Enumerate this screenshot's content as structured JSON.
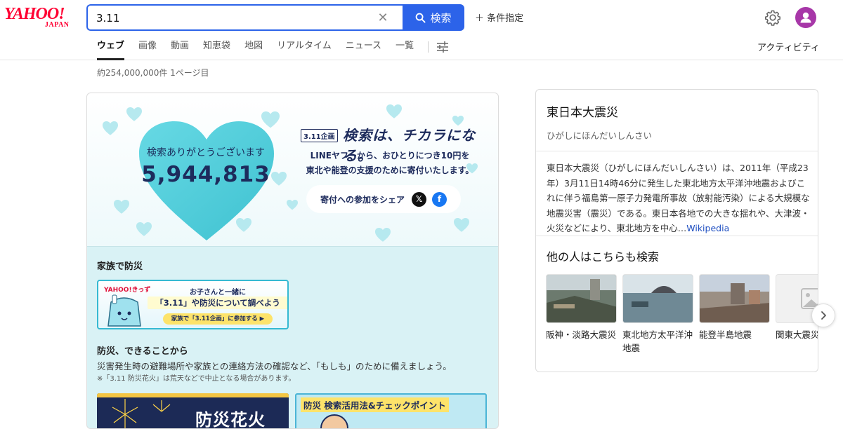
{
  "logo": {
    "line1": "YAHOO!",
    "line2": "JAPAN"
  },
  "search": {
    "query": "3.11",
    "placeholder": "",
    "button_label": "検索"
  },
  "header": {
    "conditions_label": "条件指定",
    "activity_label": "アクティビティ",
    "avatar_color": "#a737a8"
  },
  "tabs": [
    {
      "label": "ウェブ",
      "active": true
    },
    {
      "label": "画像"
    },
    {
      "label": "動画"
    },
    {
      "label": "知恵袋"
    },
    {
      "label": "地図"
    },
    {
      "label": "リアルタイム"
    },
    {
      "label": "ニュース"
    },
    {
      "label": "一覧"
    }
  ],
  "result_count": "約254,000,000件 1ページ目",
  "campaign": {
    "thanks": "検索ありがとうございます",
    "count": "5,944,813",
    "badge": "3.11企画",
    "slogan": "検索は、チカラになる。",
    "desc_line1": "LINEヤフーから、おひとりにつき10円を",
    "desc_line2": "東北や能登の支援のために寄付いたします。",
    "share_label": "寄付への参加をシェア",
    "heart_color": "#5fd0dc"
  },
  "family_section": {
    "title": "家族で防災",
    "banner_brand": "YAHOO!きっず",
    "banner_line1": "お子さんと一緒に",
    "banner_line2": "「3.11」や防災について調べよう",
    "banner_button": "家族で「3.11企画」に参加する ▶"
  },
  "prep_section": {
    "title": "防災、できることから",
    "desc": "災害発生時の避難場所や家族との連絡方法の確認など、「もしも」のために備えましょう。",
    "note": "※「3.11 防災花火」は荒天などで中止となる場合があります。",
    "fireworks_label": "防災花火",
    "check_label": "防災 検索活用法&チェックポイント"
  },
  "knowledge_panel": {
    "title": "東日本大震災",
    "reading": "ひがしにほんだいしんさい",
    "description": "東日本大震災（ひがしにほんだいしんさい）は、2011年（平成23年）3月11日14時46分に発生した東北地方太平洋沖地震およびこれに伴う福島第一原子力発電所事故（放射能汚染）による大規模な地震災害（震災）である。東日本各地での大きな揺れや、大津波・火災などにより、東北地方を中心…",
    "source_link": "Wikipedia",
    "related_title": "他の人はこちらも検索",
    "related": [
      {
        "label": "阪神・淡路大震災"
      },
      {
        "label": "東北地方太平洋沖地震"
      },
      {
        "label": "能登半島地震"
      },
      {
        "label": "関東大震災"
      }
    ]
  }
}
